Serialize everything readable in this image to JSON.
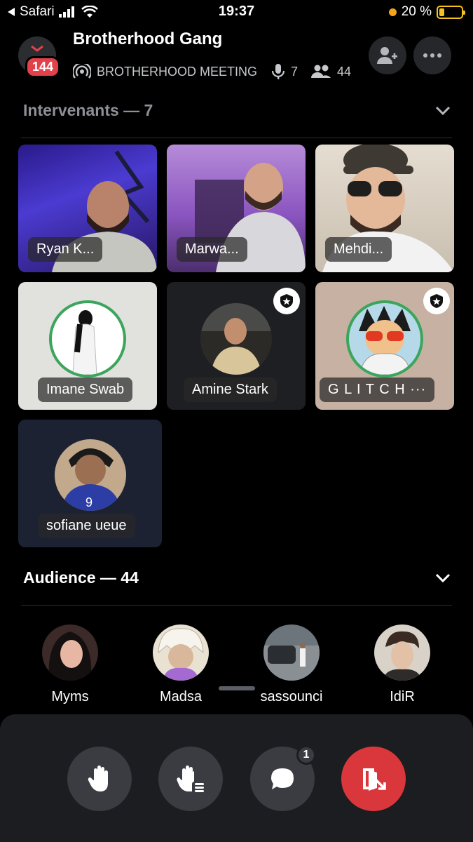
{
  "status_bar": {
    "back_app": "Safari",
    "time": "19:37",
    "battery": "20 %"
  },
  "header": {
    "title": "Brotherhood Gang",
    "badge": "144",
    "stage_name": "BROTHERHOOD MEETING",
    "speakers_count": "7",
    "listeners_count": "44"
  },
  "speakers_section": {
    "label": "Intervenants — 7",
    "tiles": [
      {
        "name": "Ryan K..."
      },
      {
        "name": "Marwa..."
      },
      {
        "name": "Mehdi..."
      },
      {
        "name": "Imane Swab"
      },
      {
        "name": "Amine Stark"
      },
      {
        "name": "G L I T C H ···"
      },
      {
        "name": "sofiane ueue"
      }
    ]
  },
  "audience_section": {
    "label": "Audience — 44",
    "members": [
      {
        "name": "Myms"
      },
      {
        "name": "Madsa"
      },
      {
        "name": "sassounci"
      },
      {
        "name": "IdiR"
      }
    ]
  },
  "bottom_bar": {
    "chat_unread": "1"
  },
  "icons": {
    "back": "back-arrow-icon",
    "signal": "signal-icon",
    "wifi": "wifi-icon",
    "invite": "add-user-icon",
    "more": "more-icon",
    "stage": "stage-icon",
    "mic": "mic-icon",
    "people": "people-icon",
    "chevron": "chevron-down-icon",
    "moderator": "moderator-icon",
    "raise_hand": "raise-hand-icon",
    "hand_list": "hand-list-icon",
    "chat": "chat-bubble-icon",
    "leave": "leave-icon"
  },
  "colors": {
    "background": "#000000",
    "tile_dark": "#1e1f22",
    "danger": "#da373c",
    "speaking_ring": "#3ba55c"
  }
}
